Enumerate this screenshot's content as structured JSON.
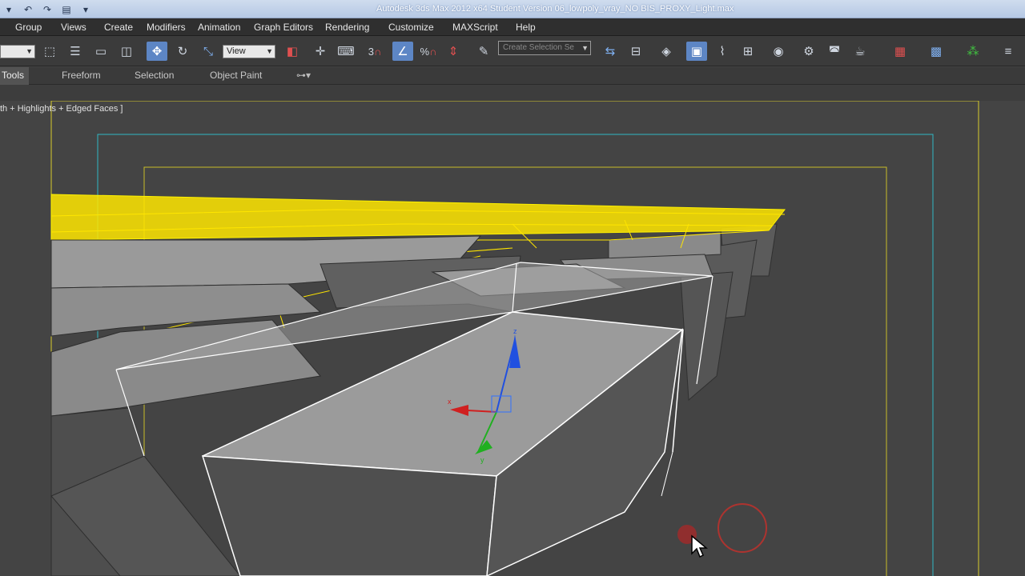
{
  "titlebar": {
    "title": "Autodesk 3ds Max  2012 x64    Student Version    06_lowpoly_vray_NO BIS_PROXY_Light.max",
    "undo_icon": "undo-icon",
    "redo_icon": "redo-icon",
    "project_icon": "project-folder-icon"
  },
  "menubar": {
    "items": [
      "Group",
      "Views",
      "Create",
      "Modifiers",
      "Animation",
      "Graph Editors",
      "Rendering",
      "Customize",
      "MAXScript",
      "Help"
    ]
  },
  "toolbar": {
    "filter_value": "",
    "reference_coord": "View",
    "named_selection_placeholder": "Create Selection Se",
    "snap_value": "3",
    "percent_snap": "%"
  },
  "ribbon": {
    "tabs": [
      "Tools",
      "Freeform",
      "Selection",
      "Object Paint"
    ],
    "extra": "▾"
  },
  "viewport": {
    "label": "th + Highlights + Edged Faces ]",
    "colors": {
      "background": "#444444",
      "selected_wire": "#ffe600",
      "white_wire": "#ffffff",
      "safe_frame_outer": "#d8cc2c",
      "safe_frame_cyan": "#2fb8c4",
      "axis_x": "#d02020",
      "axis_y": "#20b020",
      "axis_z": "#2050e0"
    },
    "gizmo_labels": {
      "x": "x",
      "y": "y",
      "z": "z"
    }
  }
}
